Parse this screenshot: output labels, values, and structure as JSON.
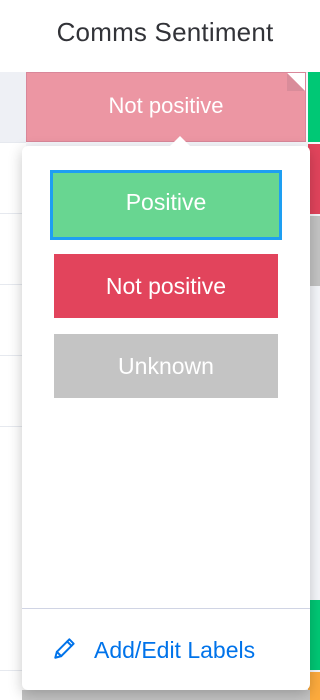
{
  "column": {
    "title": "Comms Sentiment"
  },
  "current_cell": {
    "label": "Not positive",
    "color": "#ec96a3"
  },
  "label_options": [
    {
      "label": "Positive",
      "color": "#68d691",
      "selected": true
    },
    {
      "label": "Not positive",
      "color": "#e2445c",
      "selected": false
    },
    {
      "label": "Unknown",
      "color": "#c4c4c4",
      "selected": false
    }
  ],
  "footer": {
    "edit_labels": "Add/Edit Labels",
    "icon": "pencil-icon"
  },
  "colors": {
    "accent": "#0073ea",
    "selection_border": "#1e9ff2"
  }
}
